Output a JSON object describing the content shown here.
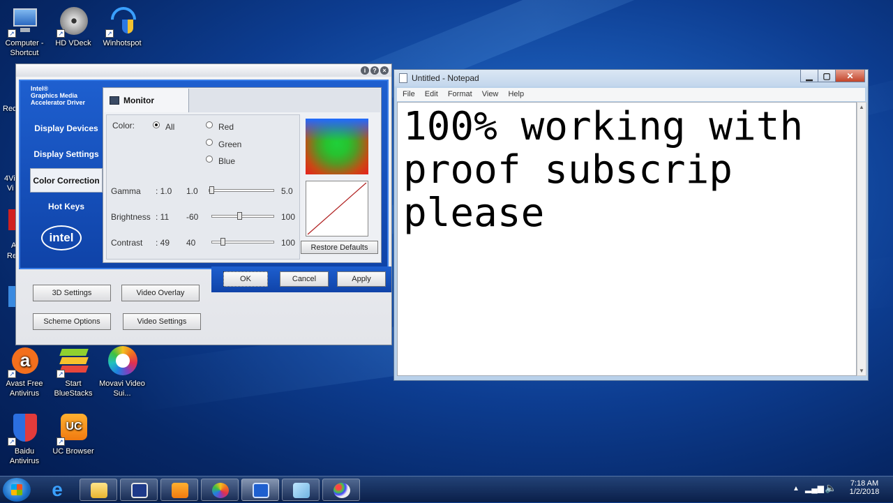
{
  "desktop": {
    "icons_left": [
      {
        "label": "Computer - Shortcut",
        "icon": "computer-icon"
      },
      {
        "label": "HD VDeck",
        "icon": "disc-icon"
      },
      {
        "label": "Winhotspot",
        "icon": "wifi-shield-icon"
      },
      {
        "label": "Avast Free Antivirus",
        "icon": "avast-icon"
      },
      {
        "label": "Start BlueStacks",
        "icon": "bluestacks-icon"
      },
      {
        "label": "Movavi Video Sui...",
        "icon": "movavi-icon"
      },
      {
        "label": "Baidu Antivirus",
        "icon": "baidu-shield-icon"
      },
      {
        "label": "UC Browser",
        "icon": "uc-browser-icon"
      }
    ],
    "partial_labels": [
      "Rec",
      "4Vi",
      "Vi",
      "A",
      "Re"
    ]
  },
  "intel": {
    "brand_lines": [
      "Intel®",
      "Graphics Media",
      "Accelerator Driver"
    ],
    "nav": [
      "Display Devices",
      "Display Settings",
      "Color Correction",
      "Hot Keys"
    ],
    "active_nav": "Color Correction",
    "logo": "intel",
    "tab": "Monitor",
    "color_label": "Color:",
    "radios": [
      {
        "label": "All",
        "checked": true
      },
      {
        "label": "Red",
        "checked": false
      },
      {
        "label": "Green",
        "checked": false
      },
      {
        "label": "Blue",
        "checked": false
      }
    ],
    "sliders": [
      {
        "label": "Gamma",
        "value": ": 1.0",
        "min": "1.0",
        "max": "5.0",
        "fraction": 0.0
      },
      {
        "label": "Brightness",
        "value": ": 11",
        "min": "-60",
        "max": "100",
        "fraction": 0.44
      },
      {
        "label": "Contrast",
        "value": ": 49",
        "min": "40",
        "max": "100",
        "fraction": 0.15
      }
    ],
    "restore_defaults": "Restore Defaults",
    "ok": "OK",
    "cancel": "Cancel",
    "apply": "Apply",
    "bottom_buttons": [
      "3D Settings",
      "Video Overlay",
      "Scheme Options",
      "Video Settings"
    ]
  },
  "notepad": {
    "title": "Untitled - Notepad",
    "menu": [
      "File",
      "Edit",
      "Format",
      "View",
      "Help"
    ],
    "text": "100% working with proof subscrip please"
  },
  "taskbar": {
    "time": "7:18 AM",
    "date": "1/2/2018"
  },
  "colors": {
    "intel_blue": "#1e5fcf",
    "notepad_frame": "#b9d1ea",
    "desktop_bg": "#0d3d91"
  }
}
